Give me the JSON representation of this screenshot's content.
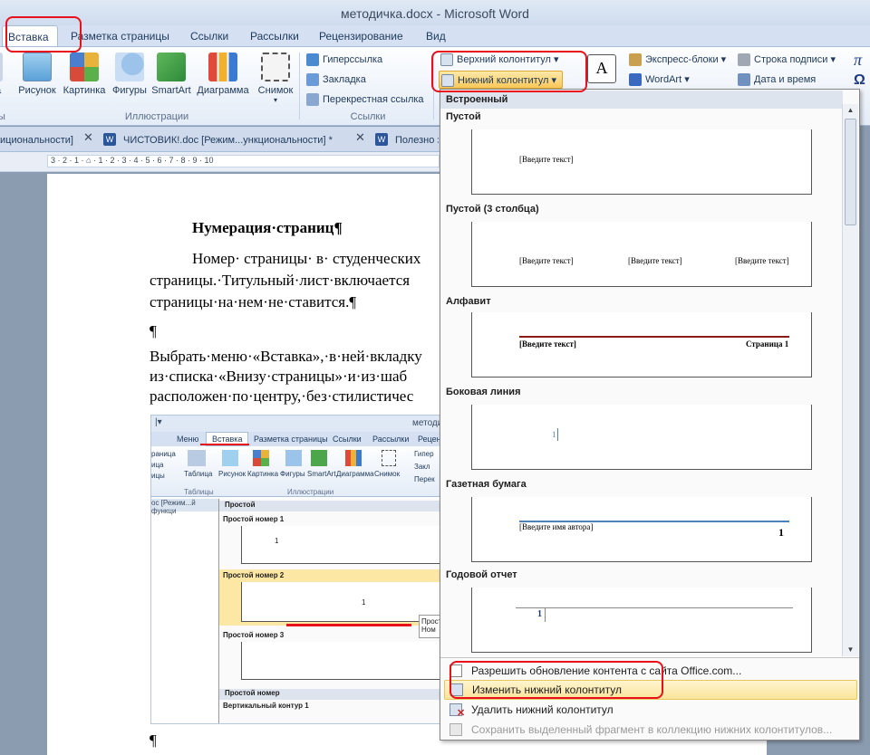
{
  "window": {
    "title": "методичка.docx  -  Microsoft Word"
  },
  "tabs": [
    "Вставка",
    "Разметка страницы",
    "Ссылки",
    "Рассылки",
    "Рецензирование",
    "Вид"
  ],
  "ribbon": {
    "illustrations": {
      "label": "Иллюстрации",
      "buttons": [
        "Рисунок",
        "Картинка",
        "Фигуры",
        "SmartArt",
        "Диаграмма",
        "Снимок"
      ]
    },
    "links": {
      "label": "Ссылки",
      "items": [
        "Гиперссылка",
        "Закладка",
        "Перекрестная ссылка"
      ]
    },
    "header_footer": {
      "items": [
        "Верхний колонтитул",
        "Нижний колонтитул"
      ]
    },
    "text": {
      "items": [
        "Экспресс-блоки",
        "WordArt",
        "Строка подписи",
        "Дата и время"
      ]
    }
  },
  "doc_tabs": [
    {
      "label": "ициональности]",
      "close": "✕"
    },
    {
      "label": "ЧИСТОВИК!.doc [Режим...ункциональности]  *",
      "close": "✕"
    },
    {
      "label": "Полезно з"
    }
  ],
  "ruler": "3 · 2 · 1 · ⌂ · 1 · 2 · 3 · 4 · 5 · 6 · 7 · 8 · 9 · 10",
  "document": {
    "heading": "Нумерация·страниц¶",
    "p1": [
      "Номер· страницы· в· студенческих",
      "страницы.·Титульный·лист·включается",
      "страницы·на·нем·не·ставится.¶"
    ],
    "para_mark": "¶",
    "p2": [
      "Выбрать·меню·«Вставка»,·в·ней·вкладку",
      "из·списка·«Внизу·страницы»·и·из·шаб",
      "расположен·по·центру,·без·стилистичес"
    ],
    "end_mark": "¶"
  },
  "embedded": {
    "title": "методи",
    "tabs": [
      "Меню",
      "Вставка",
      "Разметка страницы",
      "Ссылки",
      "Рассылки",
      "Рецен"
    ],
    "left_items": [
      "раница",
      "ица",
      "ицы"
    ],
    "buttons": [
      "Таблица",
      "Рисунок",
      "Картинка",
      "Фигуры",
      "SmartArt",
      "Диаграмма",
      "Снимок"
    ],
    "right_items": [
      "Гипер",
      "Закл",
      "Перек"
    ],
    "group_labels": [
      "Таблицы",
      "Иллюстрации"
    ],
    "doc_tab": "ос [Режим...й функци",
    "gallery": {
      "head": "Простой",
      "items": [
        "Простой номер 1",
        "Простой номер 2",
        "Простой номер 3"
      ],
      "section": "Простой номер",
      "last": "Вертикальный контур 1",
      "tip": [
        "Прост",
        "Ном"
      ]
    }
  },
  "dropdown": {
    "header": "Встроенный",
    "galleries": [
      {
        "title": "Пустой",
        "placeholders": [
          "[Введите текст]"
        ]
      },
      {
        "title": "Пустой (3 столбца)",
        "placeholders": [
          "[Введите текст]",
          "[Введите текст]",
          "[Введите текст]"
        ]
      },
      {
        "title": "Алфавит",
        "placeholders": [
          "[Введите текст]",
          "Страница 1"
        ]
      },
      {
        "title": "Боковая линия",
        "placeholders": [
          "1"
        ]
      },
      {
        "title": "Газетная бумага",
        "placeholders": [
          "[Введите имя автора]",
          "1"
        ]
      },
      {
        "title": "Годовой отчет",
        "placeholders": [
          "1"
        ]
      }
    ],
    "menu": [
      "Разрешить обновление контента с сайта Office.com...",
      "Изменить нижний колонтитул",
      "Удалить нижний колонтитул",
      "Сохранить выделенный фрагмент в коллекцию нижних колонтитулов..."
    ]
  },
  "colors": {
    "accent": "#2b579a",
    "highlight": "#fbe8a6",
    "annotation": "#e8101a"
  }
}
